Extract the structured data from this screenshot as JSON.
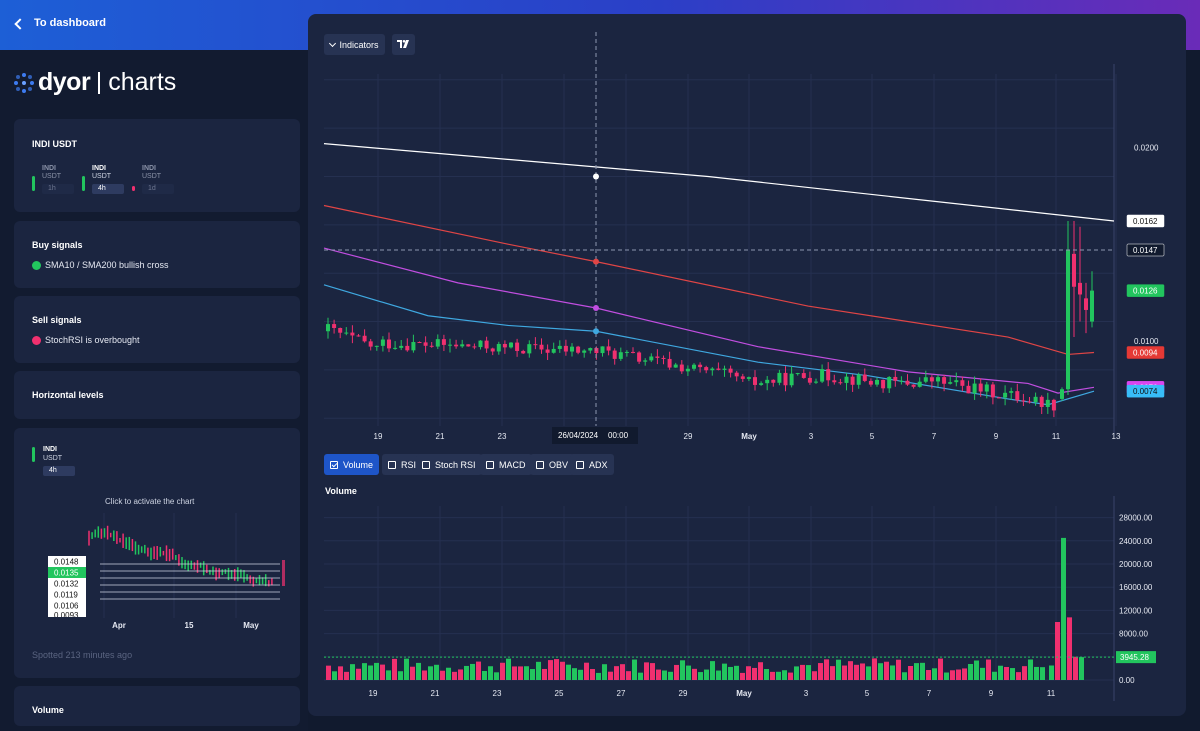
{
  "topbar": {
    "back_label": "To dashboard"
  },
  "logo": {
    "brand": "dyor",
    "product": "charts"
  },
  "pair_card": {
    "title": "INDI USDT",
    "timeframes": [
      {
        "symbol": "INDI",
        "quote": "USDT",
        "interval": "1h",
        "color": "#22c55e",
        "active": false
      },
      {
        "symbol": "INDI",
        "quote": "USDT",
        "interval": "4h",
        "color": "#22c55e",
        "active": true
      },
      {
        "symbol": "INDI",
        "quote": "USDT",
        "interval": "1d",
        "color": "#f0306f",
        "active": false
      }
    ]
  },
  "buy_signals": {
    "title": "Buy signals",
    "items": [
      {
        "text": "SMA10 / SMA200 bullish cross",
        "color": "#22c55e"
      }
    ]
  },
  "sell_signals": {
    "title": "Sell signals",
    "items": [
      {
        "text": "StochRSI is overbought",
        "color": "#f0306f"
      }
    ]
  },
  "horizontal_levels": {
    "title": "Horizontal levels",
    "mini": {
      "symbol": "INDI",
      "quote": "USDT",
      "interval": "4h",
      "hint": "Click to activate the chart",
      "levels": [
        "0.0148",
        "0.0135",
        "0.0132",
        "0.0119",
        "0.0106",
        "0.0093"
      ],
      "highlight_index": 1,
      "x_ticks": [
        "Apr",
        "15",
        "May"
      ],
      "spotted": "Spotted 213 minutes ago"
    }
  },
  "volume_card": {
    "title": "Volume"
  },
  "toolbar": {
    "indicators_label": "Indicators",
    "tv_logo": "tradingview-logo-icon"
  },
  "price_chart": {
    "y_ticks": [
      "0.0200",
      "0.0100"
    ],
    "y_tick_values": [
      0.02,
      0.01
    ],
    "y_range": [
      0.0056,
      0.0238
    ],
    "x_ticks": [
      "19",
      "21",
      "23",
      "29",
      "May",
      "3",
      "5",
      "7",
      "9",
      "11",
      "13"
    ],
    "crosshair": {
      "date": "26/04/2024",
      "time": "00:00",
      "price": "0.0147"
    },
    "price_badges": [
      {
        "label": "0.0162",
        "value": 0.0162,
        "bg": "#ffffff",
        "fg": "#111111"
      },
      {
        "label": "0.0147",
        "value": 0.0147,
        "bg": "#111a2e",
        "fg": "#ffffff"
      },
      {
        "label": "0.0126",
        "value": 0.0126,
        "bg": "#22c55e",
        "fg": "#ffffff"
      },
      {
        "label": "0.0094",
        "value": 0.0094,
        "bg": "#e53935",
        "fg": "#ffffff"
      },
      {
        "label": "0.0076",
        "value": 0.0076,
        "bg": "#d946ef",
        "fg": "#ffffff"
      },
      {
        "label": "0.0074",
        "value": 0.0074,
        "bg": "#38bdf8",
        "fg": "#111111"
      }
    ],
    "ma_colors": {
      "white": "#ffffff",
      "red": "#e04545",
      "purple": "#c14ee0",
      "blue": "#3fa8e0"
    },
    "candle_colors": {
      "up": "#22c55e",
      "down": "#f0306f"
    }
  },
  "indicator_tabs": [
    {
      "label": "Volume",
      "checked": true
    },
    {
      "label": "RSI",
      "checked": false
    },
    {
      "label": "Stoch RSI",
      "checked": false
    },
    {
      "label": "MACD",
      "checked": false
    },
    {
      "label": "OBV",
      "checked": false
    },
    {
      "label": "ADX",
      "checked": false
    }
  ],
  "volume_chart": {
    "title": "Volume",
    "y_ticks": [
      "28000.00",
      "24000.00",
      "20000.00",
      "16000.00",
      "12000.00",
      "8000.00",
      "4000.00",
      "0.00"
    ],
    "y_tick_values": [
      28000,
      24000,
      20000,
      16000,
      12000,
      8000,
      4000,
      0
    ],
    "last_value_label": "3945.28",
    "last_value": 3945.28,
    "x_ticks": [
      "19",
      "21",
      "23",
      "25",
      "27",
      "29",
      "May",
      "3",
      "5",
      "7",
      "9",
      "11"
    ]
  }
}
